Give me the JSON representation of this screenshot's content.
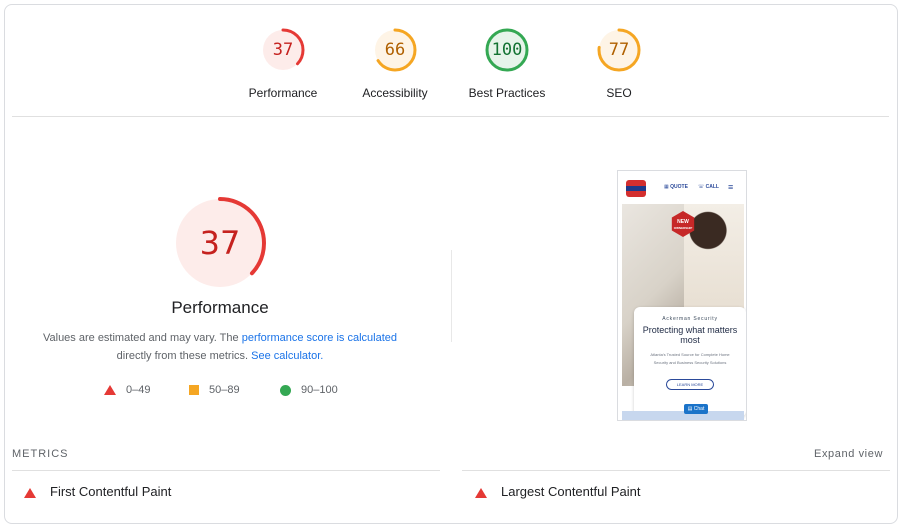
{
  "gauges": [
    {
      "score": "37",
      "label": "Performance",
      "color": "#e53935",
      "bg": "#fdecea",
      "text": "#c5221f",
      "fraction": 0.37
    },
    {
      "score": "66",
      "label": "Accessibility",
      "color": "#f5a623",
      "bg": "#fef4e6",
      "text": "#b06000",
      "fraction": 0.66
    },
    {
      "score": "100",
      "label": "Best Practices",
      "color": "#34a853",
      "bg": "#e6f4ea",
      "text": "#137333",
      "fraction": 1.0
    },
    {
      "score": "77",
      "label": "SEO",
      "color": "#f5a623",
      "bg": "#fef4e6",
      "text": "#b06000",
      "fraction": 0.77
    }
  ],
  "performance": {
    "score": "37",
    "fraction": 0.37,
    "title": "Performance",
    "desc_part1": "Values are estimated and may vary. The ",
    "desc_link1": "performance score is calculated",
    "desc_part2": "directly from these metrics. ",
    "desc_link2": "See calculator."
  },
  "legend": [
    {
      "icon": "triangle-icon",
      "text": "0–49",
      "color": "#e53935"
    },
    {
      "icon": "square-icon",
      "text": "50–89",
      "color": "#f5a623"
    },
    {
      "icon": "circle-icon",
      "text": "90–100",
      "color": "#34a853"
    }
  ],
  "screenshot": {
    "nav_quote": "QUOTE",
    "nav_call": "CALL",
    "badge": "NEW",
    "badge_sub": "OWNERSHIP",
    "brand": "Ackerman Security",
    "headline": "Protecting what matters most",
    "subtext": "Atlanta's Trusted Source for Complete Home Security and Business Security Solutions",
    "button": "LEARN MORE",
    "chat": "Chat"
  },
  "metrics": {
    "title": "METRICS",
    "expand": "Expand view",
    "items": [
      {
        "label": "First Contentful Paint",
        "status": "poor"
      },
      {
        "label": "Largest Contentful Paint",
        "status": "poor"
      }
    ]
  }
}
